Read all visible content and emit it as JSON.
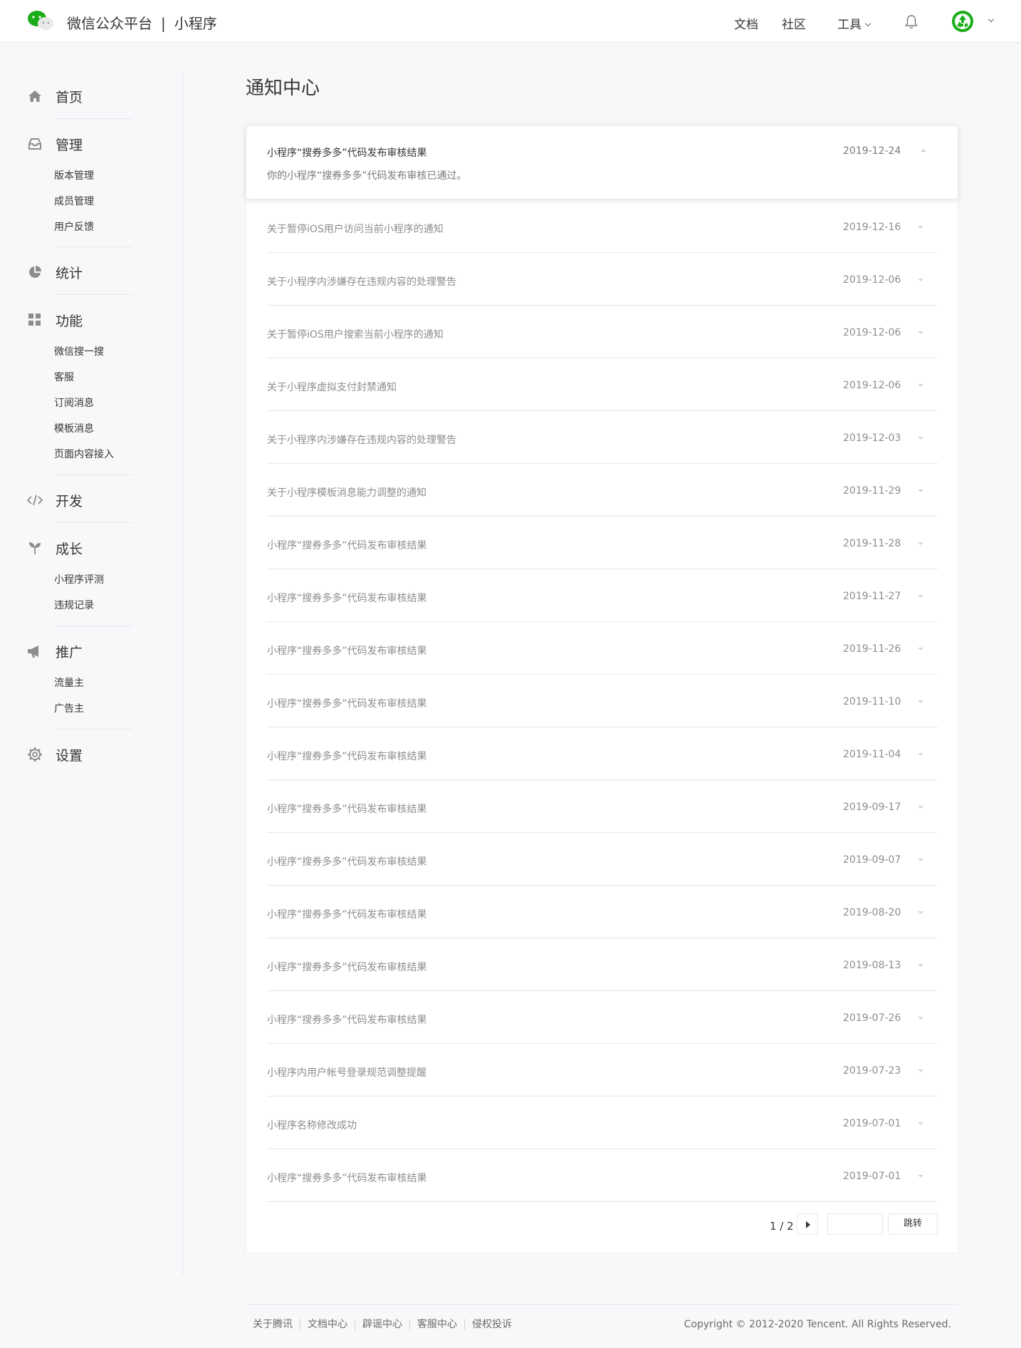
{
  "header": {
    "brand": "微信公众平台",
    "separator": "|",
    "product": "小程序",
    "nav": [
      "文档",
      "社区",
      "工具"
    ],
    "icons": [
      "wechat-logo-icon",
      "bell-icon",
      "recycle-avatar-icon",
      "chevron-down-icon"
    ]
  },
  "sidebar": {
    "groups": [
      {
        "label": "首页",
        "icon": "home-icon",
        "items": []
      },
      {
        "label": "管理",
        "icon": "inbox-icon",
        "items": [
          "版本管理",
          "成员管理",
          "用户反馈"
        ]
      },
      {
        "label": "统计",
        "icon": "pie-chart-icon",
        "items": []
      },
      {
        "label": "功能",
        "icon": "grid-icon",
        "items": [
          "微信搜一搜",
          "客服",
          "订阅消息",
          "模板消息",
          "页面内容接入"
        ]
      },
      {
        "label": "开发",
        "icon": "code-icon",
        "items": []
      },
      {
        "label": "成长",
        "icon": "sprout-icon",
        "items": [
          "小程序评测",
          "违规记录"
        ]
      },
      {
        "label": "推广",
        "icon": "megaphone-icon",
        "items": [
          "流量主",
          "广告主"
        ]
      },
      {
        "label": "设置",
        "icon": "gear-icon",
        "items": []
      }
    ]
  },
  "main": {
    "title": "通知中心",
    "expanded": {
      "title": "小程序“搜券多多”代码发布审核结果",
      "body": "你的小程序“搜券多多”代码发布审核已通过。",
      "date": "2019-12-24"
    },
    "notifications": [
      {
        "title": "关于暂停iOS用户访问当前小程序的通知",
        "date": "2019-12-16"
      },
      {
        "title": "关于小程序内涉嫌存在违规内容的处理警告",
        "date": "2019-12-06"
      },
      {
        "title": "关于暂停iOS用户搜索当前小程序的通知",
        "date": "2019-12-06"
      },
      {
        "title": "关于小程序虚拟支付封禁通知",
        "date": "2019-12-06"
      },
      {
        "title": "关于小程序内涉嫌存在违规内容的处理警告",
        "date": "2019-12-03"
      },
      {
        "title": "关于小程序模板消息能力调整的通知",
        "date": "2019-11-29"
      },
      {
        "title": "小程序“搜券多多”代码发布审核结果",
        "date": "2019-11-28"
      },
      {
        "title": "小程序“搜券多多”代码发布审核结果",
        "date": "2019-11-27"
      },
      {
        "title": "小程序“搜券多多”代码发布审核结果",
        "date": "2019-11-26"
      },
      {
        "title": "小程序“搜券多多”代码发布审核结果",
        "date": "2019-11-10"
      },
      {
        "title": "小程序“搜券多多”代码发布审核结果",
        "date": "2019-11-04"
      },
      {
        "title": "小程序“搜券多多”代码发布审核结果",
        "date": "2019-09-17"
      },
      {
        "title": "小程序“搜券多多”代码发布审核结果",
        "date": "2019-09-07"
      },
      {
        "title": "小程序“搜券多多”代码发布审核结果",
        "date": "2019-08-20"
      },
      {
        "title": "小程序“搜券多多”代码发布审核结果",
        "date": "2019-08-13"
      },
      {
        "title": "小程序“搜券多多”代码发布审核结果",
        "date": "2019-07-26"
      },
      {
        "title": "小程序内用户帐号登录规范调整提醒",
        "date": "2019-07-23"
      },
      {
        "title": "小程序名称修改成功",
        "date": "2019-07-01"
      },
      {
        "title": "小程序“搜券多多”代码发布审核结果",
        "date": "2019-07-01"
      }
    ],
    "pagination": {
      "page_text": "1 / 2",
      "go_label": "跳转",
      "input_value": ""
    }
  },
  "footer": {
    "links": [
      "关于腾讯",
      "文档中心",
      "辟谣中心",
      "客服中心",
      "侵权投诉"
    ],
    "copyright": "Copyright © 2012-2020 Tencent. All Rights Reserved."
  },
  "colors": {
    "accent": "#1aad19",
    "text": "#353535",
    "muted": "#8d8d8d",
    "background": "#f6f8f9"
  }
}
